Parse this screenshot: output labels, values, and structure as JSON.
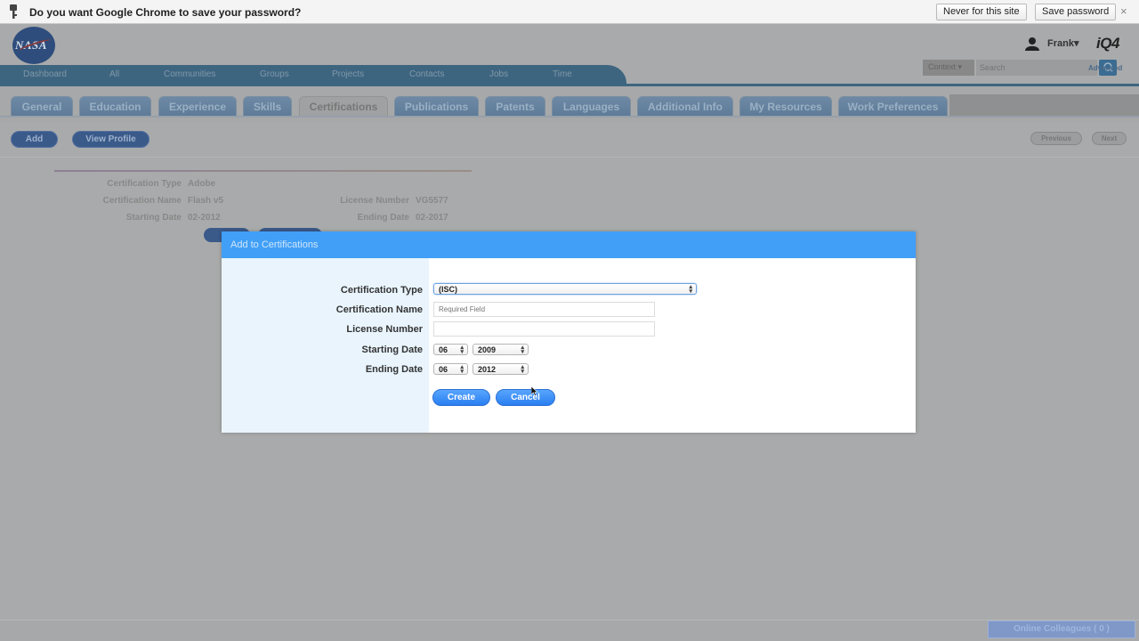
{
  "chrome_bar": {
    "message": "Do you want Google Chrome to save your password?",
    "never_label": "Never for this site",
    "save_label": "Save password",
    "close": "×"
  },
  "header": {
    "logo_text": "NASA",
    "user_name": "Frank▾",
    "brand": "iQ4",
    "search_context": "Context ▾",
    "search_placeholder": "Search",
    "advanced": "Advanced"
  },
  "topnav": [
    "Dashboard",
    "All",
    "Communities",
    "Groups",
    "Projects",
    "Contacts",
    "Jobs",
    "Time"
  ],
  "tabs": [
    {
      "label": "General"
    },
    {
      "label": "Education"
    },
    {
      "label": "Experience"
    },
    {
      "label": "Skills"
    },
    {
      "label": "Certifications"
    },
    {
      "label": "Publications"
    },
    {
      "label": "Patents"
    },
    {
      "label": "Languages"
    },
    {
      "label": "Additional Info"
    },
    {
      "label": "My Resources"
    },
    {
      "label": "Work Preferences"
    }
  ],
  "actions": {
    "add": "Add",
    "view_profile": "View Profile",
    "previous": "Previous",
    "next": "Next"
  },
  "record": {
    "type_label": "Certification Type",
    "type_value": "Adobe",
    "name_label": "Certification Name",
    "name_value": "Flash v5",
    "start_label": "Starting Date",
    "start_value": "02-2012",
    "license_label": "License Number",
    "license_value": "VG5577",
    "end_label": "Ending Date",
    "end_value": "02-2017"
  },
  "modal": {
    "title": "Add to Certifications",
    "type_label": "Certification Type",
    "type_value": "(ISC)",
    "name_label": "Certification Name",
    "name_placeholder": "Required Field",
    "license_label": "License Number",
    "start_label": "Starting Date",
    "start_month": "06",
    "start_year": "2009",
    "end_label": "Ending Date",
    "end_month": "06",
    "end_year": "2012",
    "create": "Create",
    "cancel": "Cancel"
  },
  "footer": {
    "colleagues": "Online Colleagues ( 0 )"
  }
}
